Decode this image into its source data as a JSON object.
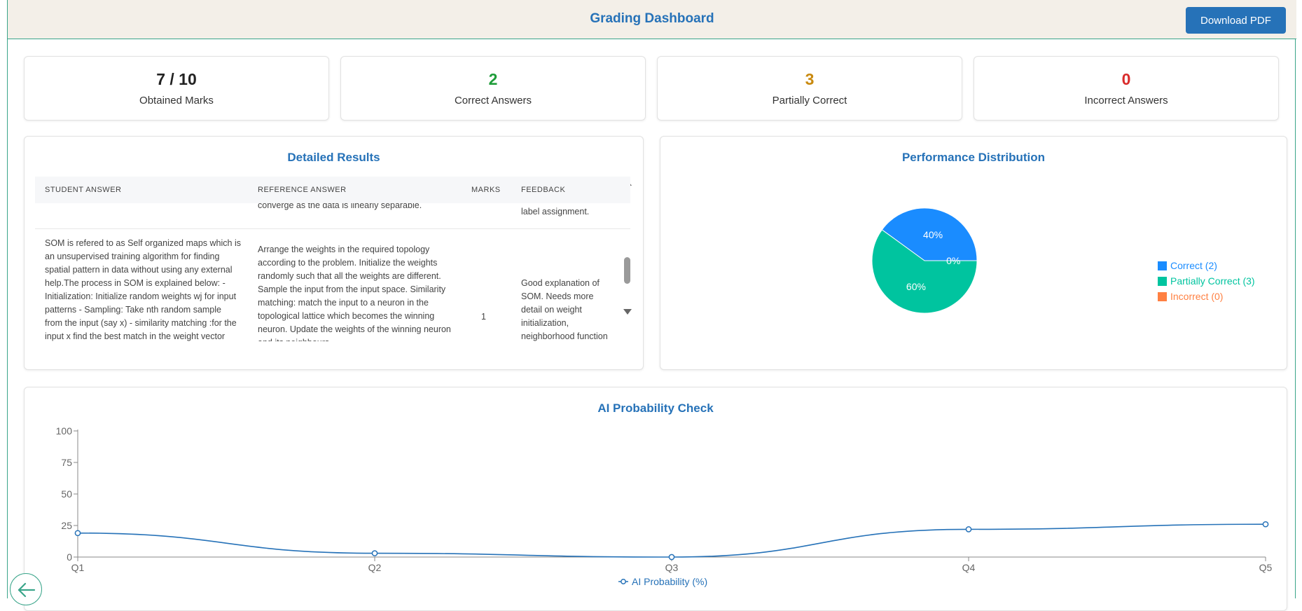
{
  "header": {
    "title": "Grading Dashboard",
    "download_label": "Download PDF"
  },
  "stats": [
    {
      "value": "7 / 10",
      "label": "Obtained Marks",
      "color": "#222222"
    },
    {
      "value": "2",
      "label": "Correct Answers",
      "color": "#1f9d3a"
    },
    {
      "value": "3",
      "label": "Partially Correct",
      "color": "#c98a10"
    },
    {
      "value": "0",
      "label": "Incorrect Answers",
      "color": "#d92b2b"
    }
  ],
  "results": {
    "title": "Detailed Results",
    "columns": [
      "STUDENT ANSWER",
      "REFERENCE ANSWER",
      "MARKS",
      "FEEDBACK"
    ],
    "prev_row": {
      "reference": "converge as the data is linearly separable.",
      "feedback": "label assignment."
    },
    "row": {
      "student": "SOM is refered to as Self organized maps which is an unsupervised training algorithm for finding spatial pattern in data without using any external help.The process in SOM is explained below: - Initialization: Initialize random weights wj for input patterns - Sampling: Take nth random sample from the input (say x) - similarity matching :for the input x find the best match in the weight vector",
      "reference": "Arrange the weights in the required topology according to the problem. Initialize the weights randomly such that all the weights are different. Sample the input from the input space. Similarity matching: match the input to a neuron in the topological lattice which becomes the winning neuron. Update the weights of the winning neuron and its neighbours",
      "marks": "1",
      "feedback": "Good explanation of SOM. Needs more detail on weight initialization, neighborhood function and"
    }
  },
  "performance": {
    "title": "Performance Distribution",
    "chart_data": {
      "type": "pie",
      "labels": [
        "Correct (2)",
        "Partially Correct (3)",
        "Incorrect (0)"
      ],
      "values": [
        40,
        60,
        0
      ],
      "value_labels": [
        "40%",
        "60%",
        "0%"
      ],
      "colors": [
        "#1a8cff",
        "#00c49f",
        "#ff8042"
      ],
      "legend": "right"
    }
  },
  "ai_check": {
    "title": "AI Probability Check",
    "chart_data": {
      "type": "line",
      "categories": [
        "Q1",
        "Q2",
        "Q3",
        "Q4",
        "Q5"
      ],
      "series": [
        {
          "name": "AI Probability (%)",
          "values": [
            19,
            3,
            0,
            22,
            26
          ]
        }
      ],
      "yticks": [
        "0",
        "25",
        "50",
        "75",
        "100"
      ],
      "ylim": [
        0,
        100
      ],
      "color": "#2672b8",
      "legend": "bottom"
    }
  },
  "icons": {
    "back": "arrow-left-icon"
  }
}
